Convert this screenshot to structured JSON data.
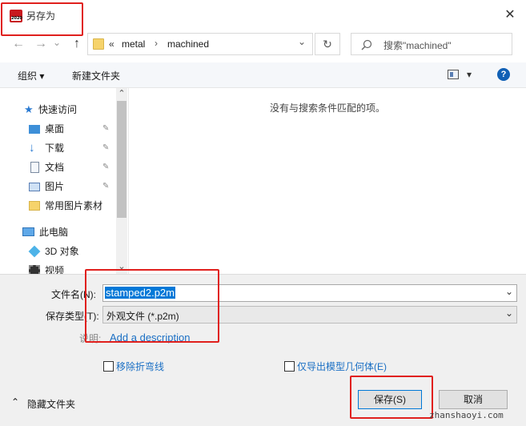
{
  "window": {
    "title": "另存为",
    "app_icon_text": "2020",
    "close_glyph": "✕"
  },
  "nav": {
    "back_glyph": "←",
    "forward_glyph": "→",
    "recent_glyph": "⌄",
    "up_glyph": "↑",
    "breadcrumb_sep0": "«",
    "breadcrumb": [
      "metal",
      "machined"
    ],
    "crumb_sep": "›",
    "addr_dropdown_glyph": "⌄",
    "refresh_glyph": "↻",
    "search_placeholder": "搜索\"machined\""
  },
  "toolbar": {
    "organize_label": "组织 ▾",
    "new_folder_label": "新建文件夹",
    "view_dropdown_glyph": "▾",
    "help_glyph": "?"
  },
  "sidebar": {
    "quick_access": "快速访问",
    "items": [
      {
        "label": "桌面",
        "pinned": true
      },
      {
        "label": "下载",
        "pinned": true
      },
      {
        "label": "文档",
        "pinned": true
      },
      {
        "label": "图片",
        "pinned": true
      },
      {
        "label": "常用图片素材",
        "pinned": false
      }
    ],
    "this_pc": "此电脑",
    "pc_items": [
      {
        "label": "3D 对象"
      },
      {
        "label": "视频"
      }
    ],
    "pin_glyph": "📌",
    "scroll_up_glyph": "⌃",
    "scroll_down_glyph": "⌄"
  },
  "content": {
    "empty_message": "没有与搜索条件匹配的项。"
  },
  "form": {
    "filename_label": "文件名(N):",
    "filename_value": "stamped2.p2m",
    "filetype_label": "保存类型(T):",
    "filetype_value": "外观文件 (*.p2m)",
    "description_label": "说明:",
    "description_link": "Add a description",
    "checkbox1_label": "移除折弯线",
    "checkbox2_label": "仅导出模型几何体(E)",
    "hide_folders_label": "隐藏文件夹",
    "save_button": "保存(S)",
    "cancel_button": "取消",
    "dropdown_glyph": "⌄"
  },
  "watermark": "zhanshaoyi.com"
}
